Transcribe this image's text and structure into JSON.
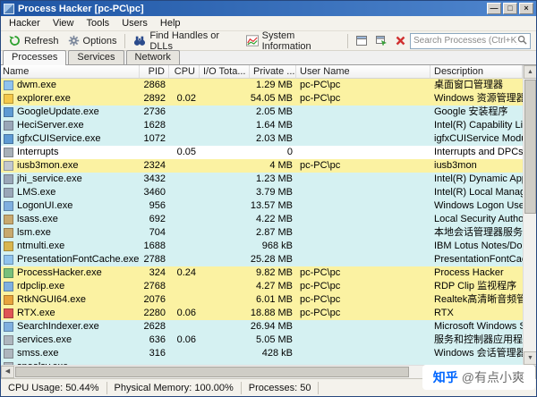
{
  "window": {
    "title": "Process Hacker [pc-PC\\pc]",
    "minimize": "—",
    "maximize": "□",
    "close": "×"
  },
  "menu": {
    "items": [
      "Hacker",
      "View",
      "Tools",
      "Users",
      "Help"
    ]
  },
  "toolbar": {
    "refresh_label": "Refresh",
    "options_label": "Options",
    "find_label": "Find Handles or DLLs",
    "sysinfo_label": "System Information",
    "search_placeholder": "Search Processes (Ctrl+K)"
  },
  "tabs": {
    "items": [
      "Processes",
      "Services",
      "Network"
    ],
    "active": "Processes"
  },
  "table": {
    "columns": [
      "Name",
      "PID",
      "CPU",
      "I/O Tota...",
      "Private ...",
      "User Name",
      "Description"
    ],
    "rows": [
      {
        "icon": "#8FC3EE",
        "name": "dwm.exe",
        "pid": "2868",
        "cpu": "",
        "io": "",
        "private": "1.29 MB",
        "user": "pc-PC\\pc",
        "desc": "桌面窗口管理器",
        "type": "own"
      },
      {
        "icon": "#F4C84A",
        "name": "explorer.exe",
        "pid": "2892",
        "cpu": "0.02",
        "io": "",
        "private": "54.05 MB",
        "user": "pc-PC\\pc",
        "desc": "Windows 资源管理器",
        "type": "own"
      },
      {
        "icon": "#5E9BD4",
        "name": "GoogleUpdate.exe",
        "pid": "2736",
        "cpu": "",
        "io": "",
        "private": "2.05 MB",
        "user": "",
        "desc": "Google 安装程序",
        "type": "service"
      },
      {
        "icon": "#9AA7B8",
        "name": "HeciServer.exe",
        "pid": "1628",
        "cpu": "",
        "io": "",
        "private": "1.64 MB",
        "user": "",
        "desc": "Intel(R) Capability Lic",
        "type": "service"
      },
      {
        "icon": "#5E9BD4",
        "name": "igfxCUIService.exe",
        "pid": "1072",
        "cpu": "",
        "io": "",
        "private": "2.03 MB",
        "user": "",
        "desc": "igfxCUIService Modu",
        "type": "service"
      },
      {
        "icon": "#A8B0B8",
        "name": "Interrupts",
        "pid": "",
        "cpu": "0.05",
        "io": "",
        "private": "0",
        "user": "",
        "desc": "Interrupts and DPCs",
        "type": "none"
      },
      {
        "icon": "#C2C8CE",
        "name": "iusb3mon.exe",
        "pid": "2324",
        "cpu": "",
        "io": "",
        "private": "4 MB",
        "user": "pc-PC\\pc",
        "desc": "iusb3mon",
        "type": "own"
      },
      {
        "icon": "#9AA7B8",
        "name": "jhi_service.exe",
        "pid": "3432",
        "cpu": "",
        "io": "",
        "private": "1.23 MB",
        "user": "",
        "desc": "Intel(R) Dynamic App",
        "type": "service"
      },
      {
        "icon": "#9AA7B8",
        "name": "LMS.exe",
        "pid": "3460",
        "cpu": "",
        "io": "",
        "private": "3.79 MB",
        "user": "",
        "desc": "Intel(R) Local Manag",
        "type": "service"
      },
      {
        "icon": "#7FB0E0",
        "name": "LogonUI.exe",
        "pid": "956",
        "cpu": "",
        "io": "",
        "private": "13.57 MB",
        "user": "",
        "desc": "Windows Logon Use",
        "type": "service"
      },
      {
        "icon": "#C8A96E",
        "name": "lsass.exe",
        "pid": "692",
        "cpu": "",
        "io": "",
        "private": "4.22 MB",
        "user": "",
        "desc": "Local Security Author",
        "type": "service"
      },
      {
        "icon": "#C8A96E",
        "name": "lsm.exe",
        "pid": "704",
        "cpu": "",
        "io": "",
        "private": "2.87 MB",
        "user": "",
        "desc": "本地会话管理器服务",
        "type": "service"
      },
      {
        "icon": "#D9B64F",
        "name": "ntmulti.exe",
        "pid": "1688",
        "cpu": "",
        "io": "",
        "private": "968 kB",
        "user": "",
        "desc": "IBM Lotus Notes/Do",
        "type": "service"
      },
      {
        "icon": "#8FC3EE",
        "name": "PresentationFontCache.exe",
        "pid": "2788",
        "cpu": "",
        "io": "",
        "private": "25.28 MB",
        "user": "",
        "desc": "PresentationFontCac",
        "type": "service"
      },
      {
        "icon": "#79C07B",
        "name": "ProcessHacker.exe",
        "pid": "324",
        "cpu": "0.24",
        "io": "",
        "private": "9.82 MB",
        "user": "pc-PC\\pc",
        "desc": "Process Hacker",
        "type": "own"
      },
      {
        "icon": "#7FB0E0",
        "name": "rdpclip.exe",
        "pid": "2768",
        "cpu": "",
        "io": "",
        "private": "4.27 MB",
        "user": "pc-PC\\pc",
        "desc": "RDP Clip 监视程序",
        "type": "own"
      },
      {
        "icon": "#E8A33D",
        "name": "RtkNGUI64.exe",
        "pid": "2076",
        "cpu": "",
        "io": "",
        "private": "6.01 MB",
        "user": "pc-PC\\pc",
        "desc": "Realtek高清晰音频管理",
        "type": "own"
      },
      {
        "icon": "#E05555",
        "name": "RTX.exe",
        "pid": "2280",
        "cpu": "0.06",
        "io": "",
        "private": "18.88 MB",
        "user": "pc-PC\\pc",
        "desc": "RTX",
        "type": "own"
      },
      {
        "icon": "#7FB0E0",
        "name": "SearchIndexer.exe",
        "pid": "2628",
        "cpu": "",
        "io": "",
        "private": "26.94 MB",
        "user": "",
        "desc": "Microsoft Windows S",
        "type": "service"
      },
      {
        "icon": "#AEB6BE",
        "name": "services.exe",
        "pid": "636",
        "cpu": "0.06",
        "io": "",
        "private": "5.05 MB",
        "user": "",
        "desc": "服务和控制器应用程序",
        "type": "service"
      },
      {
        "icon": "#AEB6BE",
        "name": "smss.exe",
        "pid": "316",
        "cpu": "",
        "io": "",
        "private": "428 kB",
        "user": "",
        "desc": "Windows 会话管理器",
        "type": "service"
      },
      {
        "icon": "#AEB6BE",
        "name": "spoolsv.exe",
        "pid": "",
        "cpu": "",
        "io": "",
        "private": "",
        "user": "",
        "desc": "",
        "type": "service"
      }
    ]
  },
  "statusbar": {
    "cpu": "CPU Usage: 50.44%",
    "memory": "Physical Memory: 100.00%",
    "processes": "Processes: 50"
  },
  "watermark": {
    "brand": "知乎",
    "handle": "@有点小爽"
  }
}
